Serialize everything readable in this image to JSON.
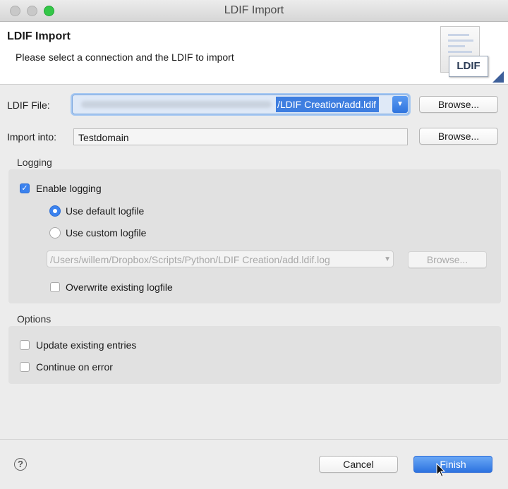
{
  "window": {
    "title": "LDIF Import"
  },
  "header": {
    "title": "LDIF Import",
    "subtitle": "Please select a connection and the LDIF to import",
    "banner_label": "LDIF"
  },
  "ldif_file": {
    "label": "LDIF File:",
    "value_visible": "/LDIF Creation/add.ldif",
    "browse_label": "Browse..."
  },
  "import_into": {
    "label": "Import into:",
    "value": "Testdomain",
    "browse_label": "Browse..."
  },
  "logging": {
    "title": "Logging",
    "enable_label": "Enable logging",
    "enable_checked": true,
    "default_label": "Use default logfile",
    "default_selected": true,
    "custom_label": "Use custom logfile",
    "custom_selected": false,
    "logfile_path": "/Users/willem/Dropbox/Scripts/Python/LDIF Creation/add.ldif.log",
    "browse_label": "Browse...",
    "overwrite_label": "Overwrite existing logfile",
    "overwrite_checked": false
  },
  "options": {
    "title": "Options",
    "update_label": "Update existing entries",
    "update_checked": false,
    "continue_label": "Continue on error",
    "continue_checked": false
  },
  "footer": {
    "help_symbol": "?",
    "cancel_label": "Cancel",
    "finish_label": "Finish"
  },
  "colors": {
    "accent": "#3b82ee",
    "selection": "#3e7ee0",
    "zoom_button": "#34c748"
  },
  "icons": {
    "close": "close-traffic-light",
    "minimize": "minimize-traffic-light",
    "zoom": "zoom-traffic-light",
    "combo_arrow": "chevron-down-icon",
    "help": "help-icon",
    "banner": "ldif-document-icon",
    "cursor": "mouse-cursor-icon"
  }
}
